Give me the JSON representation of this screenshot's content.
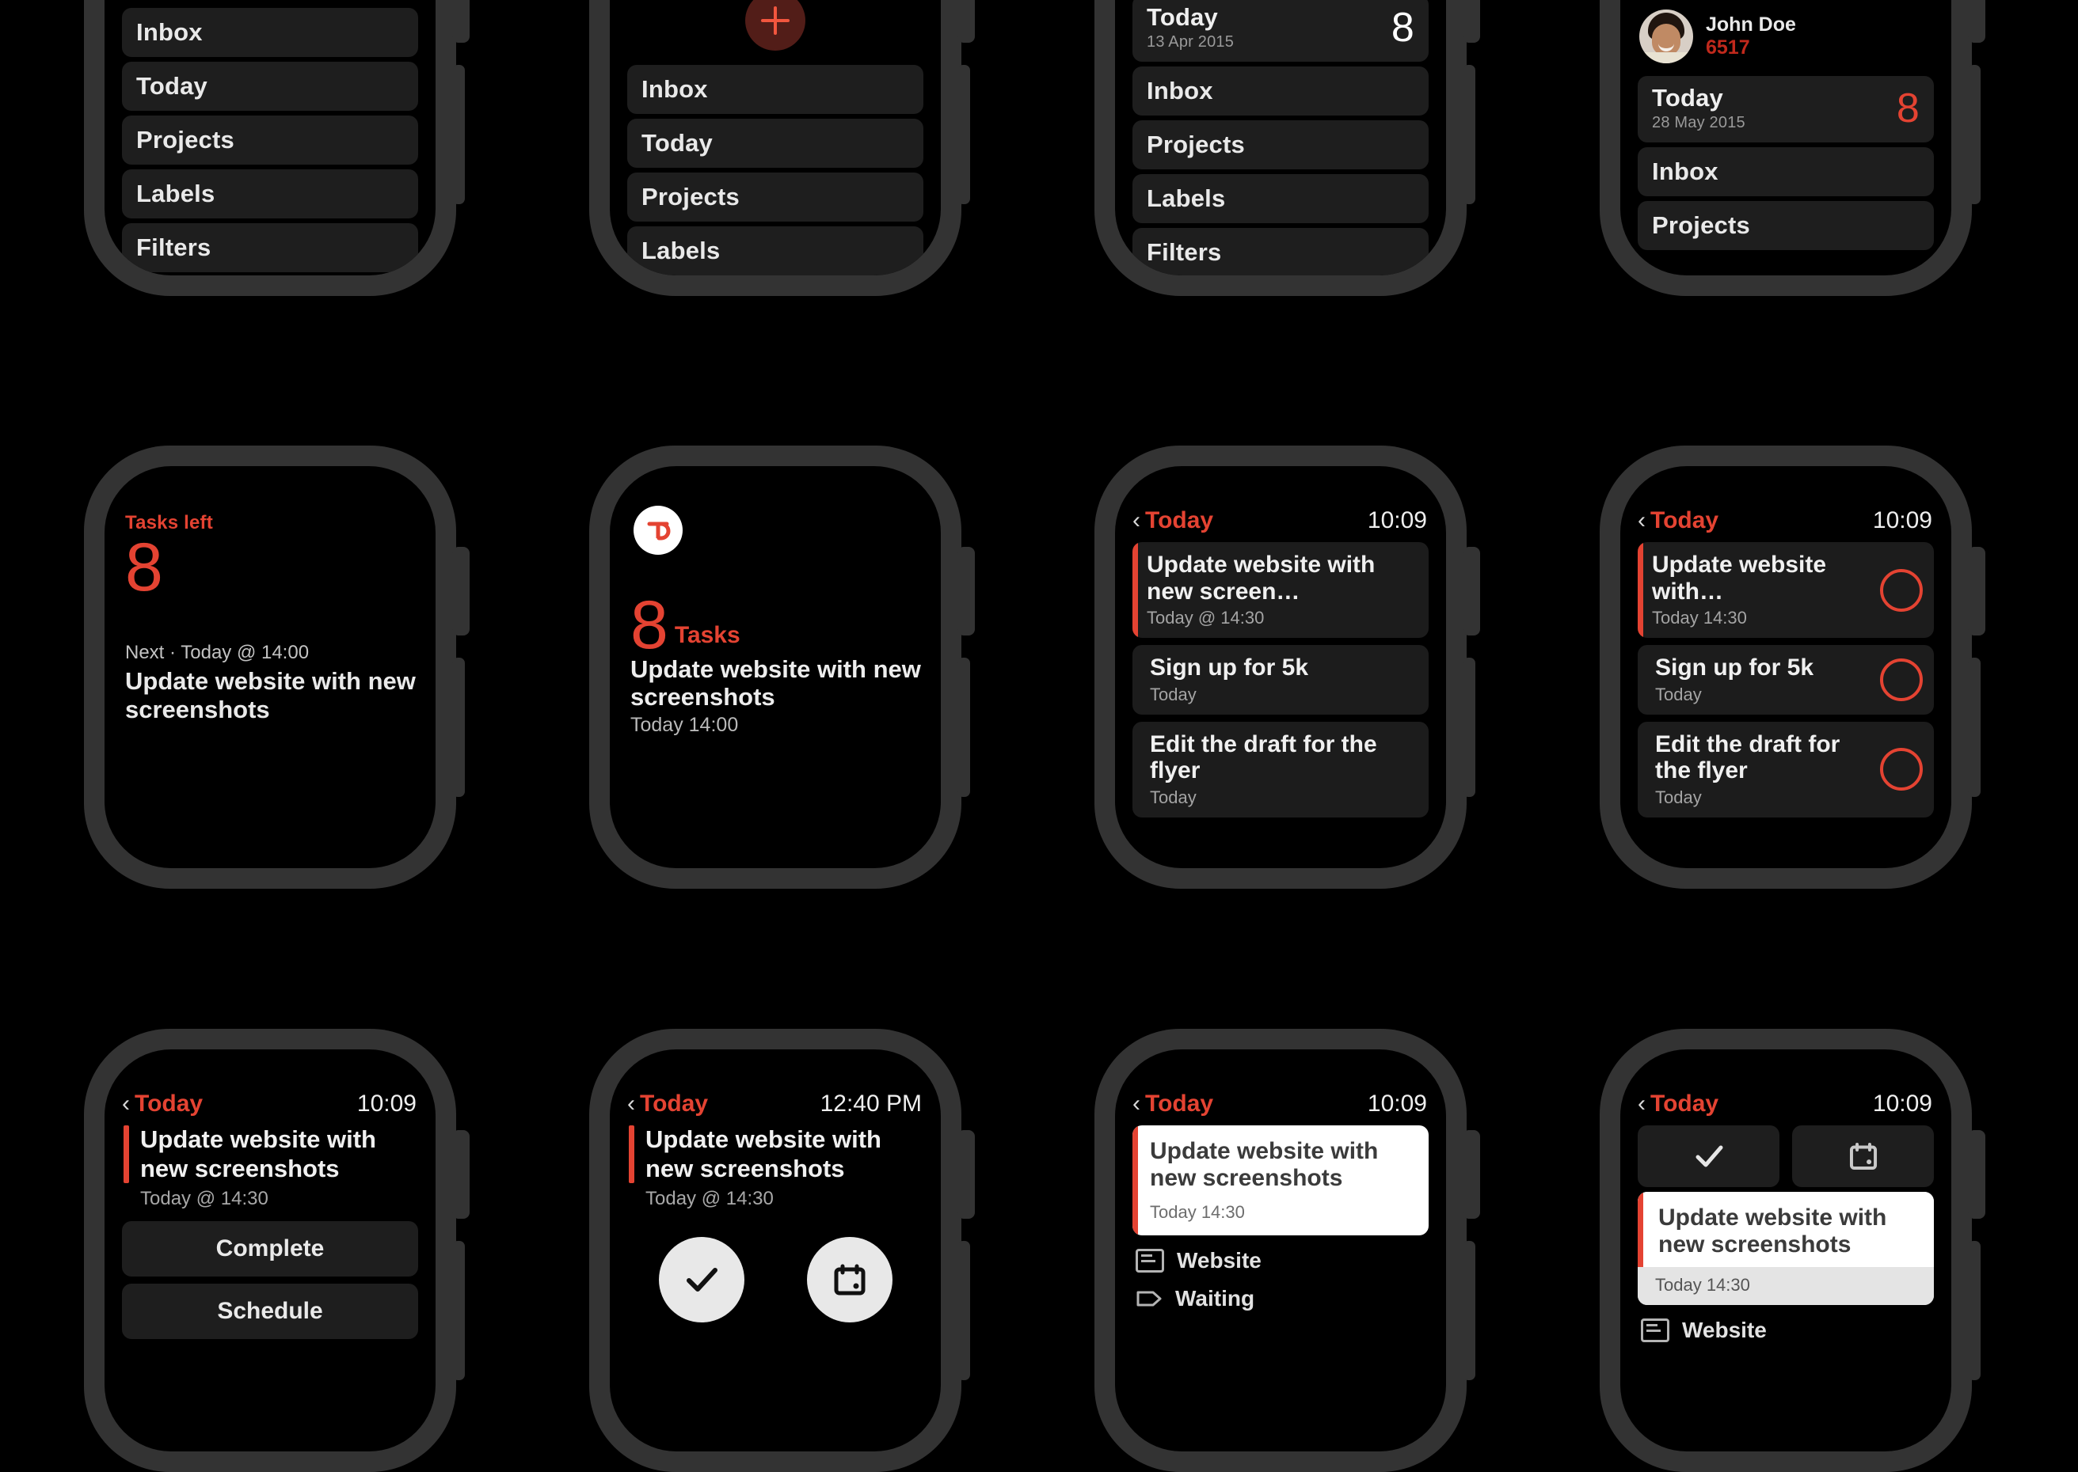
{
  "theme": {
    "background": "#000000",
    "bezel": "#333333",
    "accent_red": "#e44332",
    "card": "#1c1c1c",
    "menu_row": "#1e1e1e"
  },
  "watches": [
    {
      "id": "menu-basic",
      "type": "menu",
      "menu_items": [
        "Inbox",
        "Today",
        "Projects",
        "Labels",
        "Filters"
      ]
    },
    {
      "id": "menu-add",
      "type": "menu-add",
      "add_button": "+",
      "menu_items": [
        "Inbox",
        "Today",
        "Projects",
        "Labels"
      ]
    },
    {
      "id": "menu-today-count",
      "type": "menu-today",
      "today": {
        "label": "Today",
        "date": "13 Apr 2015",
        "count": "8",
        "count_color": "#ffffff"
      },
      "menu_items": [
        "Inbox",
        "Projects",
        "Labels",
        "Filters"
      ]
    },
    {
      "id": "menu-profile",
      "type": "menu-profile",
      "profile": {
        "name": "John Doe",
        "karma": "6517"
      },
      "today": {
        "label": "Today",
        "date": "28 May 2015",
        "count": "8",
        "count_color": "#e44332"
      },
      "menu_items": [
        "Inbox",
        "Projects"
      ]
    },
    {
      "id": "complication-tasks-left",
      "type": "widget",
      "widget": {
        "label": "Tasks left",
        "count": "8",
        "next_label": "Next · Today @ 14:00",
        "next_title": "Update website with new screenshots"
      }
    },
    {
      "id": "notification-tasks",
      "type": "notification",
      "app_icon": "todoist-logo-icon",
      "notification": {
        "count": "8",
        "count_label": "Tasks",
        "title": "Update website with new screenshots",
        "time": "Today 14:00"
      }
    },
    {
      "id": "today-list",
      "type": "list",
      "status": {
        "back": "Today",
        "time": "10:09"
      },
      "tasks": [
        {
          "title": "Update website with new screen…",
          "sub": "Today @ 14:30",
          "priority": true,
          "checkbox": false
        },
        {
          "title": "Sign up for 5k",
          "sub": "Today",
          "priority": false,
          "checkbox": false
        },
        {
          "title": "Edit the draft for the flyer",
          "sub": "Today",
          "priority": false,
          "checkbox": false
        }
      ]
    },
    {
      "id": "today-list-checkboxes",
      "type": "list",
      "status": {
        "back": "Today",
        "time": "10:09"
      },
      "tasks": [
        {
          "title": "Update website with…",
          "sub": "Today 14:30",
          "priority": true,
          "checkbox": true
        },
        {
          "title": "Sign up for 5k",
          "sub": "Today",
          "priority": false,
          "checkbox": true
        },
        {
          "title": "Edit the draft for the flyer",
          "sub": "Today",
          "priority": false,
          "checkbox": true
        }
      ]
    },
    {
      "id": "detail-buttons",
      "type": "detail-buttons",
      "status": {
        "back": "Today",
        "time": "10:09"
      },
      "detail": {
        "title": "Update website with new screenshots",
        "sub": "Today @ 14:30",
        "buttons": [
          "Complete",
          "Schedule"
        ]
      }
    },
    {
      "id": "detail-circle-actions",
      "type": "detail-circles",
      "status": {
        "back": "Today",
        "time": "12:40 PM"
      },
      "detail": {
        "title": "Update website with new screenshots",
        "sub": "Today @ 14:30"
      },
      "actions": [
        "check-icon",
        "calendar-icon"
      ]
    },
    {
      "id": "detail-white-card",
      "type": "detail-white",
      "status": {
        "back": "Today",
        "time": "10:09"
      },
      "card": {
        "title": "Update website with new screenshots",
        "sub": "Today 14:30"
      },
      "meta": [
        {
          "icon": "project-icon",
          "label": "Website"
        },
        {
          "icon": "label-tag-icon",
          "label": "Waiting"
        }
      ]
    },
    {
      "id": "detail-top-actions",
      "type": "detail-topbar",
      "status": {
        "back": "Today",
        "time": "10:09"
      },
      "actions": [
        "check-icon",
        "calendar-icon"
      ],
      "card": {
        "title": "Update website with new screenshots",
        "sub": "Today 14:30"
      },
      "meta": [
        {
          "icon": "project-icon",
          "label": "Website"
        }
      ]
    }
  ]
}
